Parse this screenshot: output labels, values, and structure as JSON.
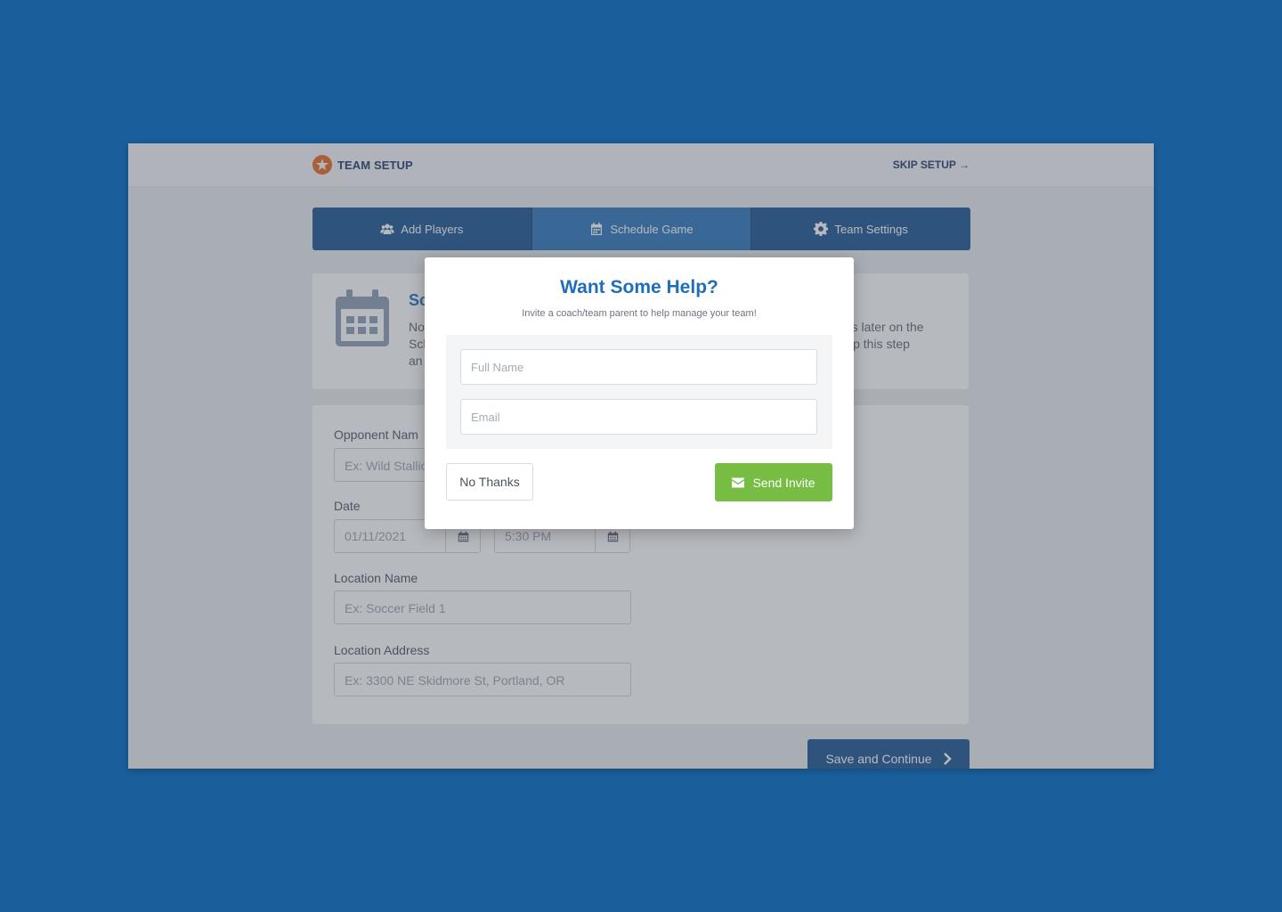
{
  "header": {
    "title": "TEAM SETUP",
    "skip_label": "SKIP SETUP →"
  },
  "tabs": [
    {
      "label": "Add Players",
      "icon": "users-icon"
    },
    {
      "label": "Schedule Game",
      "icon": "calendar-icon",
      "active": true
    },
    {
      "label": "Team Settings",
      "icon": "gear-icon"
    }
  ],
  "intro_card": {
    "title_fragment": "Sc",
    "text_left_lines": [
      "No",
      "Sch",
      "an"
    ],
    "text_right_lines": [
      "nes later on the",
      "skip this step"
    ]
  },
  "form": {
    "opponent_label": "Opponent Nam",
    "opponent_placeholder": "Ex: Wild Stallio",
    "date_label": "Date",
    "date_value": "01/11/2021",
    "time_value": "5:30 PM",
    "location_name_label": "Location Name",
    "location_name_placeholder": "Ex: Soccer Field 1",
    "location_address_label": "Location Address",
    "location_address_placeholder": "Ex: 3300 NE Skidmore St, Portland, OR"
  },
  "save_button": "Save and Continue",
  "modal": {
    "title": "Want Some Help?",
    "subtitle": "Invite a coach/team parent to help manage your team!",
    "full_name_placeholder": "Full Name",
    "email_placeholder": "Email",
    "no_thanks": "No Thanks",
    "send_invite": "Send Invite"
  },
  "colors": {
    "background": "#1a5f9c",
    "primary": "#16508f",
    "title_blue": "#1f6fb8",
    "brand_orange": "#e8641c",
    "send_green": "#77bd43"
  }
}
